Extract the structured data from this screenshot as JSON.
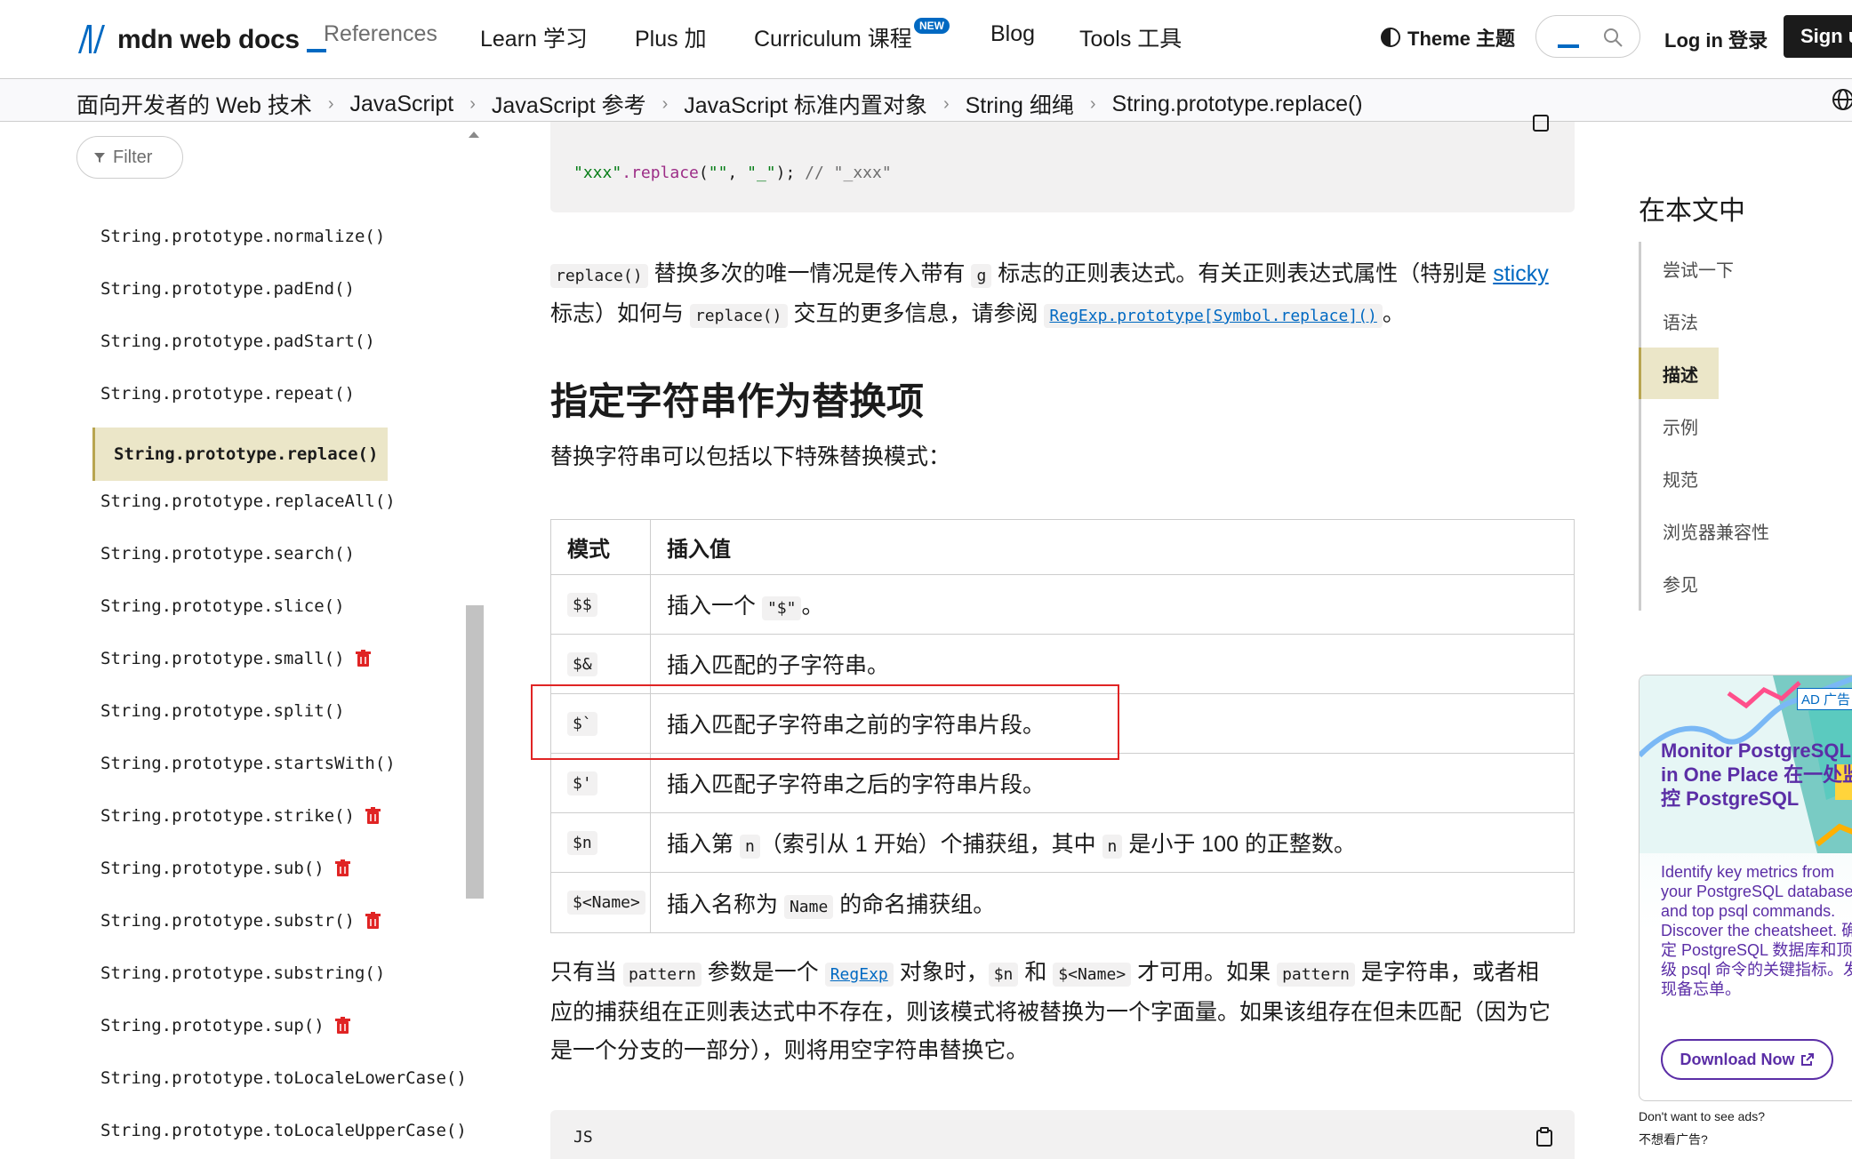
{
  "nav": {
    "logo_text": "mdn web docs",
    "references": "References",
    "learn": "Learn  学习",
    "plus": "Plus  加",
    "curriculum": "Curriculum  课程",
    "new_badge": "NEW",
    "blog": "Blog",
    "tools": "Tools  工具",
    "theme": "Theme  主题",
    "login": "Log in  登录",
    "signup": "Sign up"
  },
  "breadcrumb": [
    "面向开发者的 Web 技术",
    "JavaScript",
    "JavaScript 参考",
    "JavaScript 标准内置对象",
    "String  细绳",
    "String.prototype.replace()"
  ],
  "sidebar": {
    "filter_label": "Filter",
    "items": [
      {
        "label": "String.prototype.normalize()",
        "deprecated": false
      },
      {
        "label": "String.prototype.padEnd()",
        "deprecated": false
      },
      {
        "label": "String.prototype.padStart()",
        "deprecated": false
      },
      {
        "label": "String.prototype.repeat()",
        "deprecated": false
      },
      {
        "label": "String.prototype.replace()",
        "deprecated": false,
        "active": true
      },
      {
        "label": "String.prototype.replaceAll()",
        "deprecated": false
      },
      {
        "label": "String.prototype.search()",
        "deprecated": false
      },
      {
        "label": "String.prototype.slice()",
        "deprecated": false
      },
      {
        "label": "String.prototype.small()",
        "deprecated": true
      },
      {
        "label": "String.prototype.split()",
        "deprecated": false
      },
      {
        "label": "String.prototype.startsWith()",
        "deprecated": false
      },
      {
        "label": "String.prototype.strike()",
        "deprecated": true
      },
      {
        "label": "String.prototype.sub()",
        "deprecated": true
      },
      {
        "label": "String.prototype.substr()",
        "deprecated": true
      },
      {
        "label": "String.prototype.substring()",
        "deprecated": false
      },
      {
        "label": "String.prototype.sup()",
        "deprecated": true
      },
      {
        "label": "String.prototype.toLocaleLowerCase()",
        "deprecated": false
      },
      {
        "label": "String.prototype.toLocaleUpperCase()",
        "deprecated": false
      }
    ]
  },
  "main": {
    "code1": {
      "str1": "\"xxx\"",
      "fn": ".replace",
      "args_open": "(",
      "str2": "\"\"",
      "comma": ", ",
      "str3": "\"_\"",
      "close": ");",
      "comment": " // \"_xxx\""
    },
    "para1": {
      "t1": "replace()",
      "t2": " 替换多次的唯一情况是传入带有 ",
      "t3": "g",
      "t4": " 标志的正则表达式。有关正则表达式属性（特别是 ",
      "link1": "sticky",
      "t5": " 标志）如何与 ",
      "t6": "replace()",
      "t7": " 交互的更多信息，请参阅 ",
      "link2": "RegExp.prototype[Symbol.replace]()",
      "t8": "。"
    },
    "heading": "指定字符串作为替换项",
    "intro": "替换字符串可以包括以下特殊替换模式：",
    "table": {
      "header_pattern": "模式",
      "header_value": "插入值",
      "rows": [
        {
          "pattern": "$$",
          "value_parts": [
            "插入一个 ",
            "\"$\"",
            "。"
          ]
        },
        {
          "pattern": "$&",
          "value_parts": [
            "插入匹配的子字符串。"
          ]
        },
        {
          "pattern": "$`",
          "value_parts": [
            "插入匹配子字符串之前的字符串片段。"
          ]
        },
        {
          "pattern": "$'",
          "value_parts": [
            "插入匹配子字符串之后的字符串片段。"
          ]
        },
        {
          "pattern": "$n",
          "value_parts": [
            "插入第 ",
            "n",
            "（索引从 1 开始）个捕获组，其中 ",
            "n",
            " 是小于 100 的正整数。"
          ]
        },
        {
          "pattern": "$<Name>",
          "value_parts": [
            "插入名称为 ",
            "Name",
            " 的命名捕获组。"
          ]
        }
      ]
    },
    "para2": {
      "t1": "只有当 ",
      "c1": "pattern",
      "t2": " 参数是一个 ",
      "link": "RegExp",
      "t3": " 对象时，",
      "c2": "$n",
      "t4": " 和 ",
      "c3": "$<Name>",
      "t5": " 才可用。如果 ",
      "c4": "pattern",
      "t6": " 是字符串，或者相应的捕获组在正则表达式中不存在，则该模式将被替换为一个字面量。如果该组存在但未匹配（因为它是一个分支的一部分），则将用空字符串替换它。"
    },
    "code2_label": "JS"
  },
  "toc": {
    "title": "在本文中",
    "items": [
      "尝试一下",
      "语法",
      "描述",
      "示例",
      "规范",
      "浏览器兼容性",
      "参见"
    ],
    "active_index": 2
  },
  "ad": {
    "badge": "AD 广告",
    "title": "Monitor PostgreSQL in One Place 在一处监控 PostgreSQL",
    "body": "Identify key metrics from your PostgreSQL databases and top psql commands. Discover the cheatsheet. 确定 PostgreSQL 数据库和顶级 psql 命令的关键指标。发现备忘单。",
    "button": "Download Now",
    "foot1": "Don't want to see ads?",
    "foot2": "不想看广告?"
  },
  "colors": {
    "accent": "#0069c2",
    "active_bg": "#ebe6c8",
    "highlight": "#e02424",
    "deprecated": "#e02424",
    "ad_text": "#5b2ea6"
  }
}
